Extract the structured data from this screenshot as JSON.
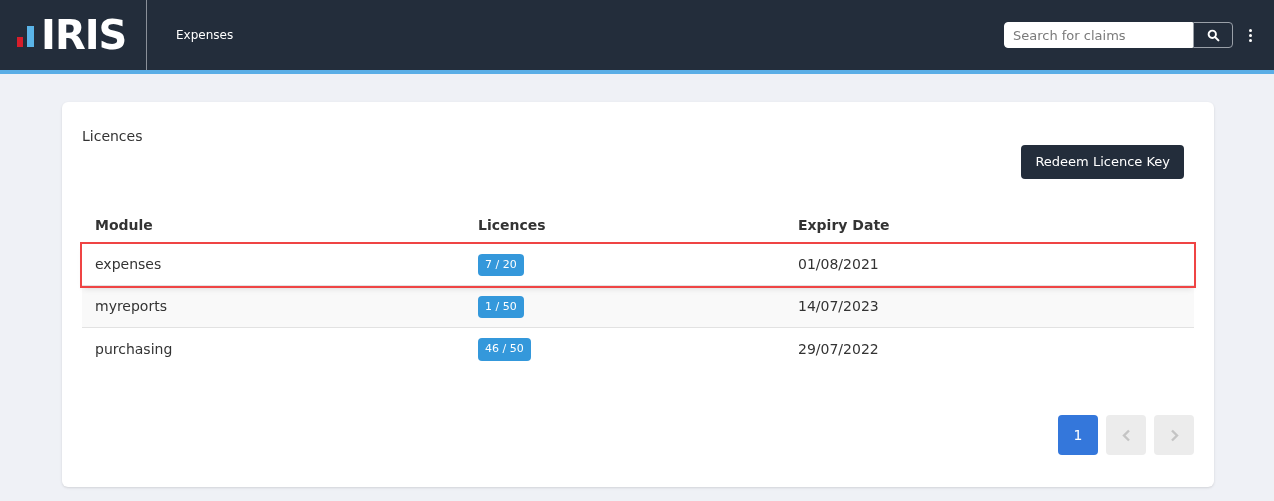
{
  "header": {
    "logo": "IRIS",
    "nav_title": "Expenses",
    "search": {
      "placeholder": "Search for claims"
    }
  },
  "card": {
    "title": "Licences",
    "redeem_button": "Redeem Licence Key",
    "table": {
      "columns": [
        "Module",
        "Licences",
        "Expiry Date"
      ],
      "rows": [
        {
          "module": "expenses",
          "licences": "7 / 20",
          "expiry": "01/08/2021",
          "highlighted": true
        },
        {
          "module": "myreports",
          "licences": "1 / 50",
          "expiry": "14/07/2023",
          "highlighted": false
        },
        {
          "module": "purchasing",
          "licences": "46 / 50",
          "expiry": "29/07/2022",
          "highlighted": false
        }
      ]
    },
    "pagination": {
      "pages": [
        {
          "label": "1",
          "selected": true
        }
      ],
      "prev_disabled": true,
      "next_disabled": true
    }
  }
}
